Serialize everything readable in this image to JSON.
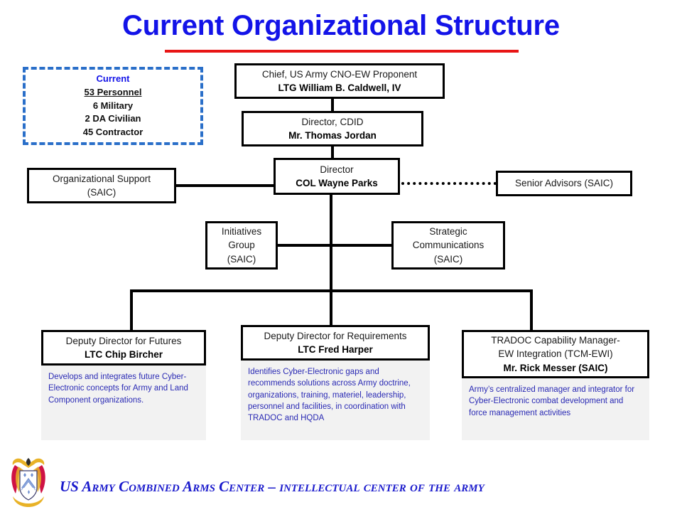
{
  "slide": {
    "title": "Current Organizational Structure",
    "accent_title_color": "#1313e8",
    "accent_rule_color": "#e81515",
    "highlight_frame_color": "#12a852"
  },
  "personnel_box": {
    "heading": "Current",
    "total": "53 Personnel",
    "lines": [
      "6 Military",
      "2 DA Civilian",
      "45 Contractor"
    ]
  },
  "nodes": {
    "chief": {
      "role": "Chief, US Army CNO-EW Proponent",
      "person": "LTG William B. Caldwell, IV"
    },
    "cdid": {
      "role": "Director, CDID",
      "person": "Mr. Thomas Jordan"
    },
    "director": {
      "role": "Director",
      "person": "COL Wayne Parks"
    },
    "org_support": {
      "line1": "Organizational Support",
      "line2": "(SAIC)"
    },
    "senior_advisors": {
      "line1": "Senior Advisors (SAIC)"
    },
    "initiatives": {
      "line1": "Initiatives",
      "line2": "Group",
      "line3": "(SAIC)"
    },
    "strategic_comms": {
      "line1": "Strategic",
      "line2": "Communications",
      "line3": "(SAIC)"
    },
    "futures": {
      "role": "Deputy Director for Futures",
      "person": "LTC Chip Bircher",
      "description": "Develops and integrates future Cyber-Electronic concepts for Army and Land Component organizations."
    },
    "requirements": {
      "role": "Deputy Director for Requirements",
      "person": "LTC Fred Harper",
      "description": "Identifies Cyber-Electronic gaps and recommends solutions across Army doctrine, organizations, training, materiel, leadership, personnel and facilities, in coordination with TRADOC and HQDA"
    },
    "tcmewi": {
      "role_line1": "TRADOC Capability Manager-",
      "role_line2": "EW Integration (TCM-EWI)",
      "person": "Mr. Rick Messer (SAIC)",
      "description": "Army’s centralized manager and integrator for Cyber-Electronic combat development and force management activities"
    }
  },
  "footer": {
    "text": "US Army Combined Arms Center – intellectual center of the army",
    "logo_name": "cac-crest-logo"
  }
}
